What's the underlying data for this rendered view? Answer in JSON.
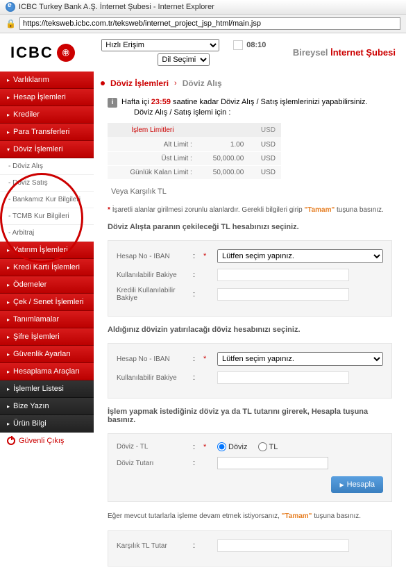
{
  "window": {
    "title": "ICBC Turkey Bank A.Ş. İnternet Şubesi - Internet Explorer",
    "url": "https://teksweb.icbc.com.tr/teksweb/internet_project_jsp_html/main.jsp"
  },
  "header": {
    "logo": "ICBC",
    "logo_badge": "㊥",
    "quick_access": "Hızlı Erişim",
    "lang": "Dil Seçimi",
    "time": "08:10",
    "brand1": "Bireysel",
    "brand2": "İnternet Şubesi"
  },
  "sidebar": {
    "items": [
      {
        "label": "Varlıklarım",
        "type": "main"
      },
      {
        "label": "Hesap İşlemleri",
        "type": "main"
      },
      {
        "label": "Krediler",
        "type": "main"
      },
      {
        "label": "Para Transferleri",
        "type": "main"
      },
      {
        "label": "Döviz İşlemleri",
        "type": "main"
      },
      {
        "label": "Döviz Alış",
        "type": "sub"
      },
      {
        "label": "Döviz Satış",
        "type": "sub"
      },
      {
        "label": "Bankamız Kur Bilgileri",
        "type": "sub"
      },
      {
        "label": "TCMB Kur Bilgileri",
        "type": "sub"
      },
      {
        "label": "Arbitraj",
        "type": "sub"
      },
      {
        "label": "Yatırım İşlemleri",
        "type": "main"
      },
      {
        "label": "Kredi Kartı İşlemleri",
        "type": "main"
      },
      {
        "label": "Ödemeler",
        "type": "main"
      },
      {
        "label": "Çek / Senet İşlemleri",
        "type": "main"
      },
      {
        "label": "Tanımlamalar",
        "type": "main"
      },
      {
        "label": "Şifre İşlemleri",
        "type": "main"
      },
      {
        "label": "Güvenlik Ayarları",
        "type": "main"
      },
      {
        "label": "Hesaplama Araçları",
        "type": "main"
      },
      {
        "label": "İşlemler Listesi",
        "type": "dark"
      },
      {
        "label": "Bize Yazın",
        "type": "dark"
      },
      {
        "label": "Ürün Bilgi",
        "type": "dark"
      }
    ],
    "logout": "Güvenli Çıkış"
  },
  "breadcrumb": {
    "main": "Döviz İşlemleri",
    "sub": "Döviz Alış"
  },
  "info": {
    "text1": "Hafta içi ",
    "time": "23:59",
    "text2": " saatine kadar Döviz Alış / Satış işlemlerinizi yapabilirsiniz.",
    "text3": "Döviz Alış / Satış işlemi için :"
  },
  "limits": {
    "header1": "İşlem Limitleri",
    "header2": "USD",
    "rows": [
      {
        "label": "Alt Limit :",
        "value": "1.00",
        "curr": "USD"
      },
      {
        "label": "Üst Limit :",
        "value": "50,000.00",
        "curr": "USD"
      },
      {
        "label": "Günlük Kalan Limit :",
        "value": "50,000.00",
        "curr": "USD"
      }
    ],
    "or": "Veya Karşılık TL"
  },
  "required_note": {
    "text1": "İşaretli alanlar girilmesi zorunlu alanlardır. Gerekli bilgileri girip ",
    "tamam": "\"Tamam\"",
    "text2": " tuşuna basınız."
  },
  "sections": {
    "s1_title": "Döviz Alışta paranın çekileceği TL hesabınızı seçiniz.",
    "s2_title": "Aldığınız dövizin yatırılacağı döviz hesabınızı seçiniz.",
    "s3_title": "İşlem yapmak istediğiniz döviz ya da TL tutarını girerek, Hesapla tuşuna basınız."
  },
  "form": {
    "hesap_label": "Hesap No - IBAN",
    "select_placeholder": "Lütfen seçim yapınız.",
    "bakiye_label": "Kullanılabilir Bakiye",
    "kredili_label": "Kredili Kullanılabilir Bakiye",
    "doviz_tl_label": "Döviz - TL",
    "radio_doviz": "Döviz",
    "radio_tl": "TL",
    "tutar_label": "Döviz Tutarı",
    "btn_calc": "Hesapla",
    "karsilik_label": "Karşılık TL Tutar"
  },
  "continue": {
    "text1": "Eğer mevcut tutarlarla işleme devam etmek istiyorsanız, ",
    "tamam": "\"Tamam\"",
    "text2": " tuşuna basınız."
  }
}
